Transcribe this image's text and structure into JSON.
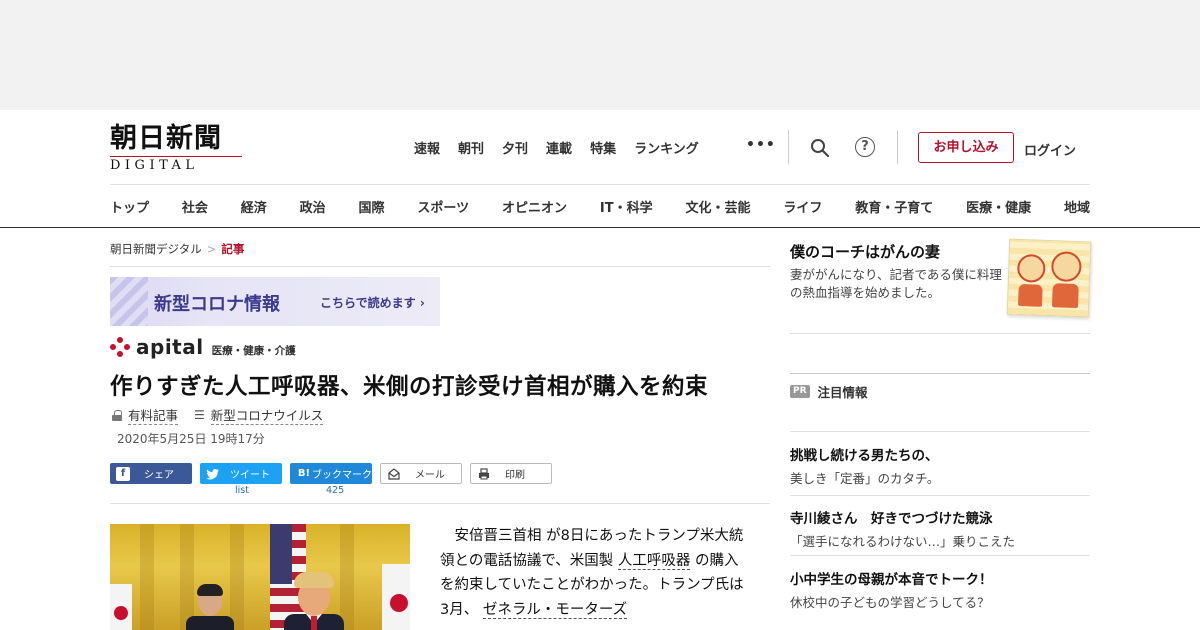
{
  "header": {
    "logo_main": "朝日新聞",
    "logo_sub": "DIGITAL",
    "top_nav": [
      "速報",
      "朝刊",
      "夕刊",
      "連載",
      "特集",
      "ランキング"
    ],
    "apply_label": "お申し込み",
    "login_label": "ログイン",
    "categories": [
      "トップ",
      "社会",
      "経済",
      "政治",
      "国際",
      "スポーツ",
      "オピニオン",
      "IT・科学",
      "文化・芸能",
      "ライフ",
      "教育・子育て",
      "医療・健康",
      "地域"
    ]
  },
  "breadcrumb": {
    "home": "朝日新聞デジタル",
    "current": "記事"
  },
  "covid_banner": {
    "title": "新型コロナ情報",
    "more": "こちらで読めます ›"
  },
  "apital": {
    "logo": "apital",
    "category": "医療・健康・介護"
  },
  "article": {
    "headline": "作りすぎた人工呼吸器、米側の打診受け首相が購入を約束",
    "paid_label": "有料記事",
    "topic_label": "新型コロナウイルス",
    "date": "2020年5月25日 19時17分",
    "body": {
      "p1": "安倍晋三首相",
      "p2": "が8日にあったトランプ米大統領との電話協議で、米国製",
      "kw1": "人工呼吸器",
      "p3": "の購入を約束していたことがわかった。トランプ氏は3月、",
      "kw2": "ゼネラル・モーターズ"
    }
  },
  "share": {
    "facebook": "シェア",
    "twitter": "ツイート",
    "twitter_count": "list",
    "hatena": "ブックマーク",
    "hatena_icon": "B!",
    "hatena_count": "425",
    "mail": "メール",
    "print": "印刷"
  },
  "sidebar": {
    "promo": {
      "title": "僕のコーチはがんの妻",
      "desc": "妻ががんになり、記者である僕に料理の熱血指導を始めました。"
    },
    "pr": {
      "badge": "PR",
      "label": "注目情報",
      "items": [
        {
          "title": "挑戦し続ける男たちの、",
          "sub": "美しき「定番」のカタチ。"
        },
        {
          "title": "寺川綾さん　好きでつづけた競泳",
          "sub": "「選手になれるわけない…」乗りこえた"
        },
        {
          "title": "小中学生の母親が本音でトーク！",
          "sub": "休校中の子どもの学習どうしてる？"
        }
      ]
    }
  },
  "colors": {
    "brand_red": "#b3122c",
    "covid_purple": "#3b3a8f",
    "facebook": "#3b5998",
    "twitter": "#1da1f2",
    "hatena": "#1f88d8"
  }
}
